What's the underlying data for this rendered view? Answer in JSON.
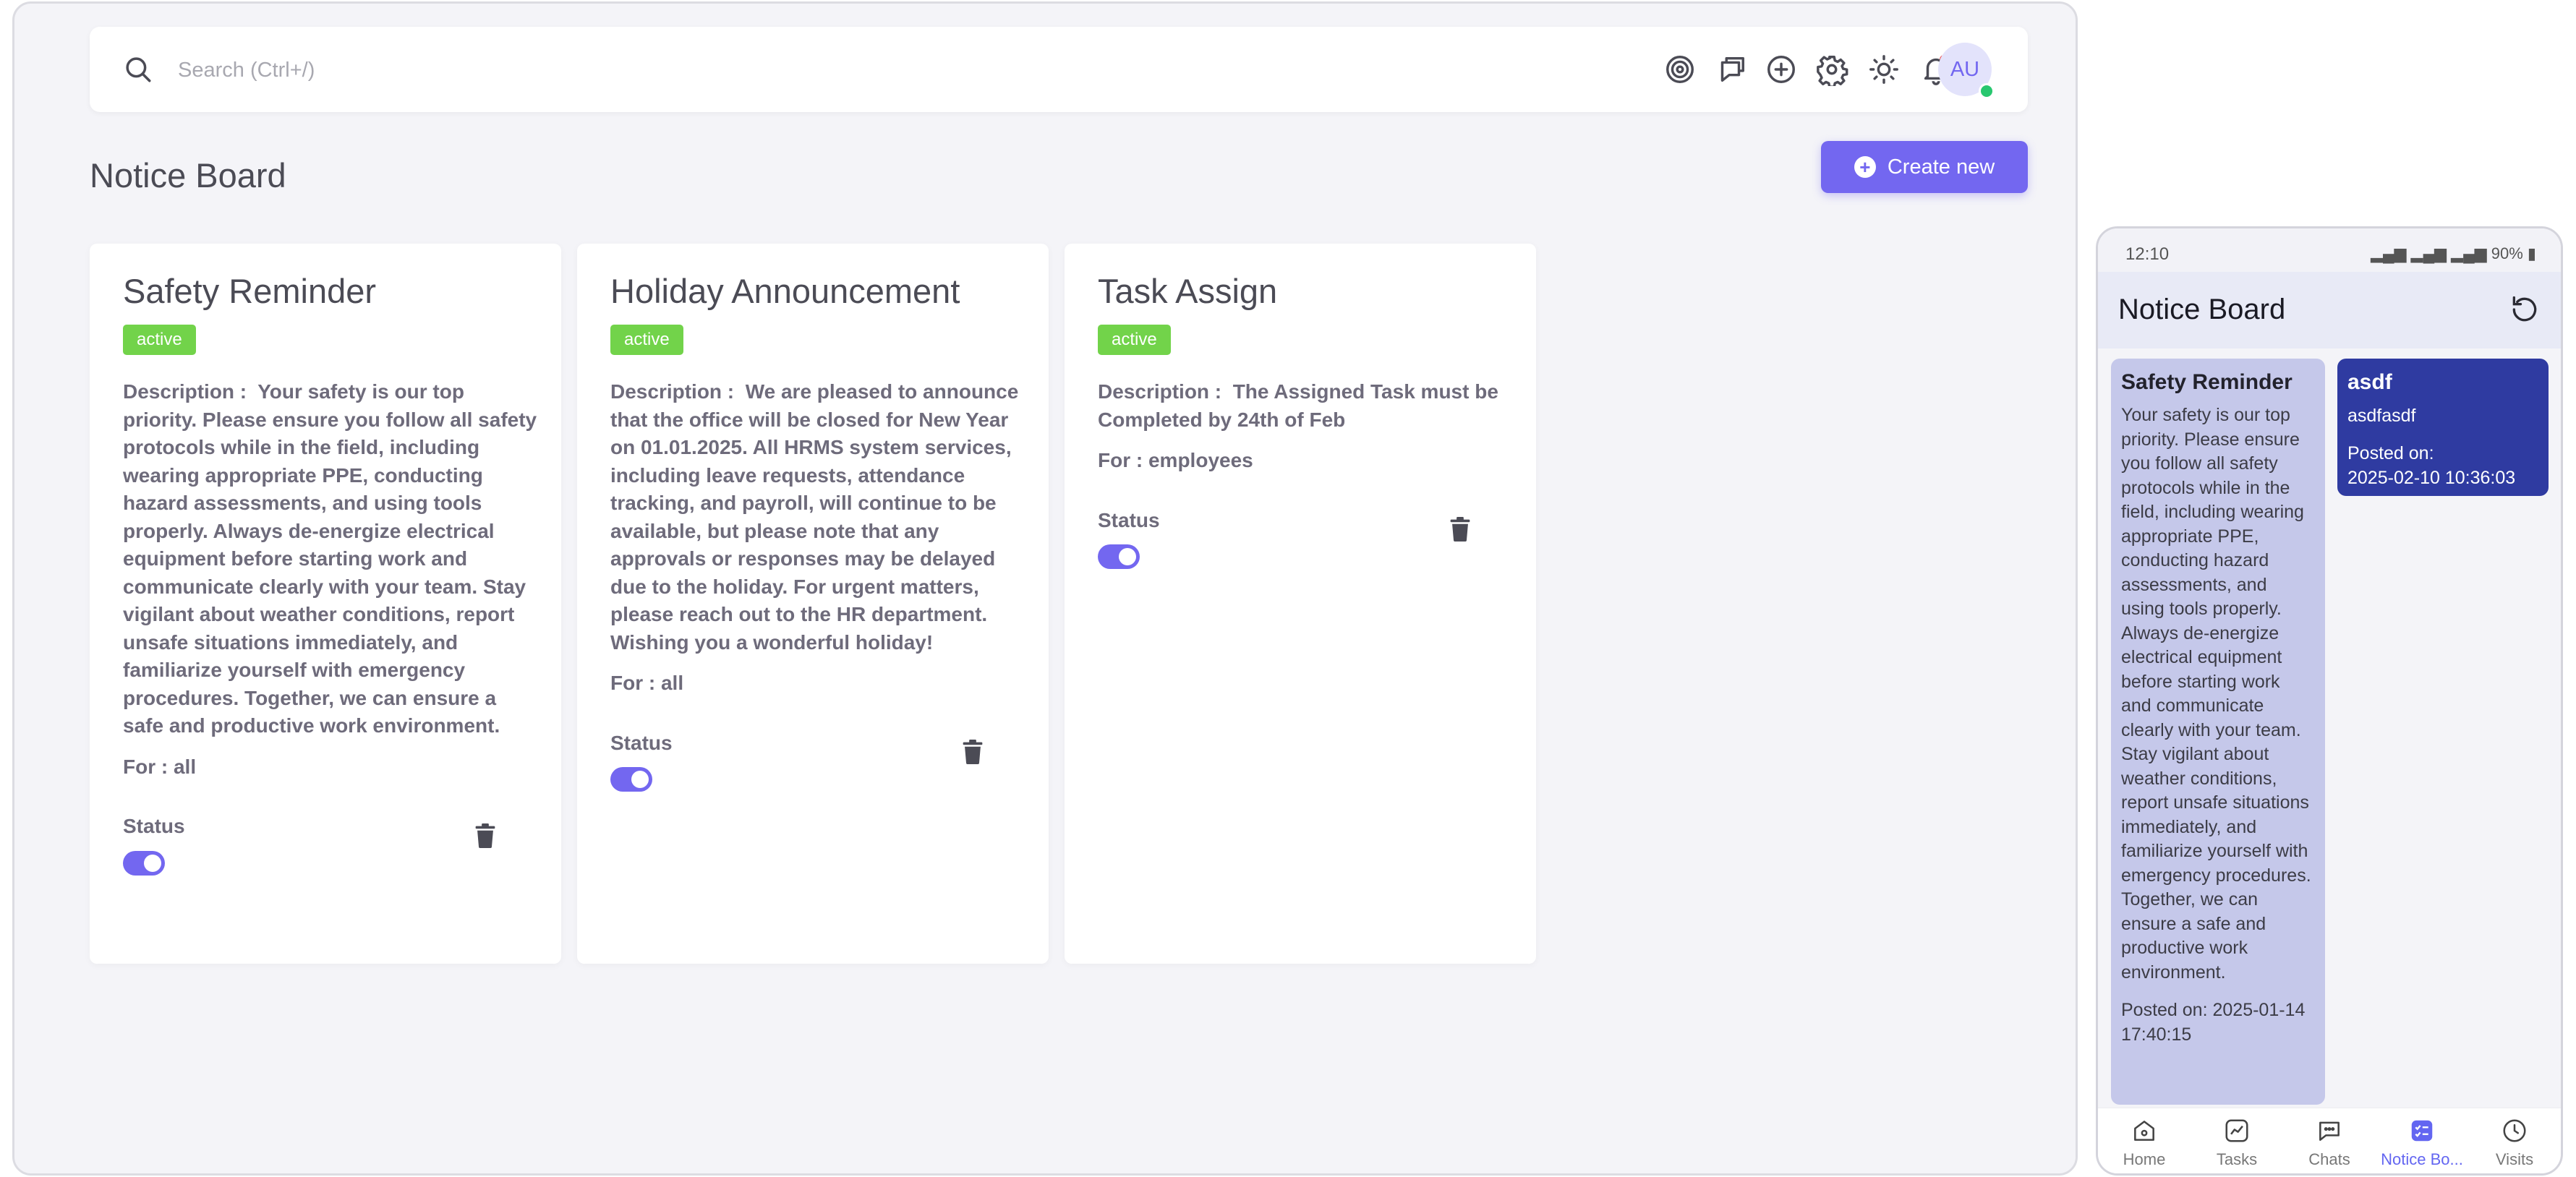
{
  "desktop": {
    "search": {
      "placeholder": "Search (Ctrl+/)"
    },
    "toolbar_icons": [
      "target-icon",
      "chat-bubbles-icon",
      "plus-circle-icon",
      "gear-icon",
      "sun-icon",
      "bell-icon"
    ],
    "avatar": "AU",
    "page_title": "Notice Board",
    "create_button": "Create new",
    "cards": [
      {
        "title": "Safety Reminder",
        "badge": "active",
        "description_label": "Description :",
        "description": "Your safety is our top priority. Please ensure you follow all safety protocols while in the field, including wearing appropriate PPE, conducting hazard assessments, and using tools properly. Always de-energize electrical equipment before starting work and communicate clearly with your team. Stay vigilant about weather conditions, report unsafe situations immediately, and familiarize yourself with emergency procedures. Together, we can ensure a safe and productive work environment.",
        "for": "For : all",
        "status_label": "Status",
        "status_on": true
      },
      {
        "title": "Holiday Announcement",
        "badge": "active",
        "description_label": "Description :",
        "description": "We are pleased to announce that the office will be closed for New Year on 01.01.2025. All HRMS system services, including leave requests, attendance tracking, and payroll, will continue to be available, but please note that any approvals or responses may be delayed due to the holiday. For urgent matters, please reach out to the HR department. Wishing you a wonderful holiday!",
        "for": "For : all",
        "status_label": "Status",
        "status_on": true
      },
      {
        "title": "Task Assign",
        "badge": "active",
        "description_label": "Description :",
        "description": "The Assigned Task must be Completed by 24th of Feb",
        "for": "For : employees",
        "status_label": "Status",
        "status_on": true
      }
    ]
  },
  "mobile": {
    "time": "12:10",
    "battery": "90%",
    "title": "Notice Board",
    "cards": [
      {
        "title": "Safety Reminder",
        "description": "Your safety is our top priority. Please ensure you follow all safety protocols while in the field, including wearing appropriate PPE, conducting hazard assessments, and using tools properly. Always de-energize electrical equipment before starting work and communicate clearly with your team. Stay vigilant about weather conditions, report unsafe situations immediately, and familiarize yourself with emergency procedures. Together, we can ensure a safe and productive work environment.",
        "posted": "Posted on: 2025-01-14 17:40:15",
        "background": "#c5c8ea"
      },
      {
        "title": "asdf",
        "description": "asdfasdf",
        "posted": "Posted on:\n2025-02-10 10:36:03",
        "background": "#2f3ba1"
      }
    ],
    "nav": [
      {
        "label": "Home",
        "icon": "home-icon"
      },
      {
        "label": "Tasks",
        "icon": "chart-icon"
      },
      {
        "label": "Chats",
        "icon": "chat-icon"
      },
      {
        "label": "Notice Bo...",
        "icon": "notice-board-icon",
        "active": true
      },
      {
        "label": "Visits",
        "icon": "clock-icon"
      }
    ]
  },
  "colors": {
    "accent": "#7367f0",
    "badge_active": "#72d34a",
    "mobile_nav_active": "#6366f1"
  }
}
